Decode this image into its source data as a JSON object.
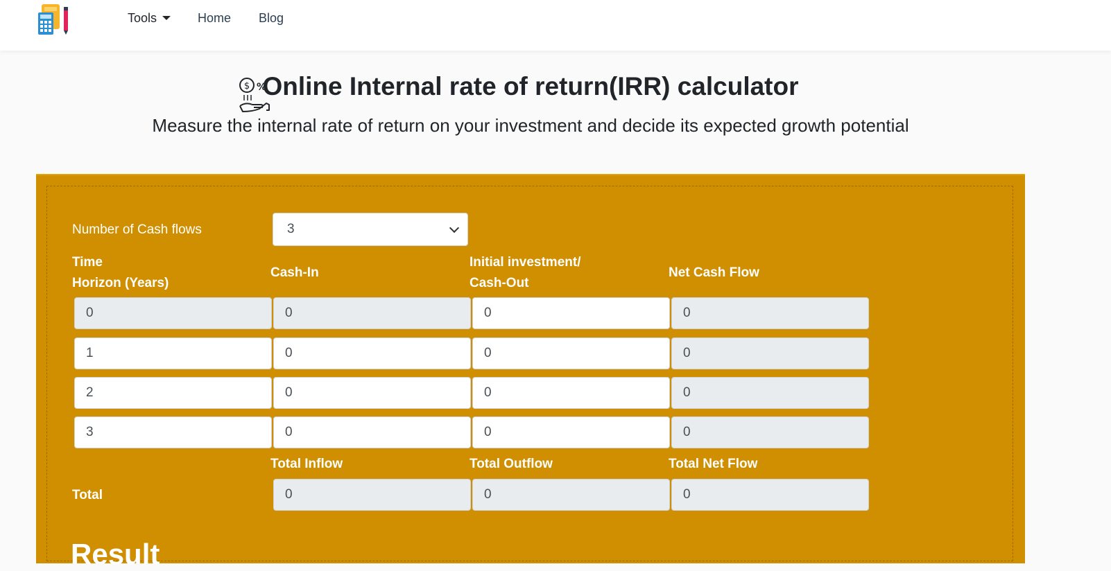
{
  "nav": {
    "tools_label": "Tools",
    "home_label": "Home",
    "blog_label": "Blog"
  },
  "header": {
    "title": "Online Internal rate of return(IRR) calculator",
    "subtitle": "Measure the internal rate of return on your investment and decide its expected growth potential"
  },
  "calculator": {
    "cash_flows_label": "Number of Cash flows",
    "cash_flows_selected": "3",
    "columns": {
      "time_line1": "Time",
      "time_line2": "Horizon (Years)",
      "cash_in": "Cash-In",
      "cash_out_line1": "Initial investment/",
      "cash_out_line2": "Cash-Out",
      "net": "Net Cash Flow"
    },
    "rows": [
      {
        "time": "0",
        "cash_in": "0",
        "cash_out": "0",
        "net": "0"
      },
      {
        "time": "1",
        "cash_in": "0",
        "cash_out": "0",
        "net": "0"
      },
      {
        "time": "2",
        "cash_in": "0",
        "cash_out": "0",
        "net": "0"
      },
      {
        "time": "3",
        "cash_in": "0",
        "cash_out": "0",
        "net": "0"
      }
    ],
    "totals": {
      "label": "Total",
      "inflow_label": "Total Inflow",
      "outflow_label": "Total Outflow",
      "net_label": "Total Net Flow",
      "inflow_value": "0",
      "outflow_value": "0",
      "net_value": "0"
    },
    "result_heading": "Result"
  },
  "colors": {
    "panel": "#d08f00",
    "readonly_field": "#e9ecef"
  }
}
